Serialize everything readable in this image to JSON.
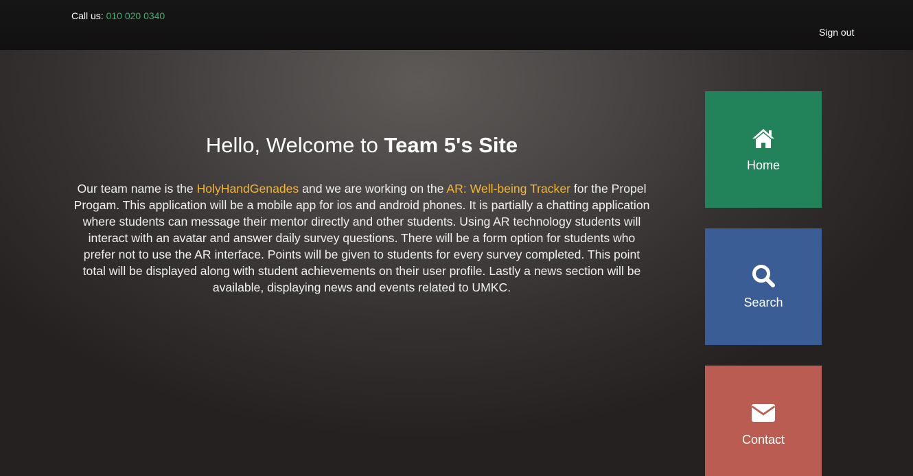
{
  "header": {
    "call_label": "Call us:",
    "phone": "010 020 0340",
    "sign_out": "Sign out"
  },
  "main": {
    "welcome_prefix": "Hello, Welcome to ",
    "welcome_bold": "Team 5's Site",
    "desc_part1": "Our team name is the ",
    "team_name": "HolyHandGenades",
    "desc_part2": " and we are working on the ",
    "project_name": "AR: Well-being Tracker",
    "desc_part3": " for the Propel Progam. This application will be a mobile app for ios and android phones. It is partially a chatting application where students can message their mentor directly and other students. Using AR technology students will interact with an avatar and answer daily survey questions. There will be a form option for students who prefer not to use the AR interface. Points will be given to students for every survey completed. This point total will be displayed along with student achievements on their user profile. Lastly a news section will be available, displaying news and events related to UMKC."
  },
  "nav_tiles": [
    {
      "label": "Home",
      "icon": "home-icon",
      "color": "#22825a"
    },
    {
      "label": "Search",
      "icon": "search-icon",
      "color": "#3b5d95"
    },
    {
      "label": "Contact",
      "icon": "envelope-icon",
      "color": "#ba5c51"
    }
  ],
  "colors": {
    "phone_link": "#3fae6a",
    "highlight_link": "#f2b637",
    "topbar": "#141212"
  }
}
